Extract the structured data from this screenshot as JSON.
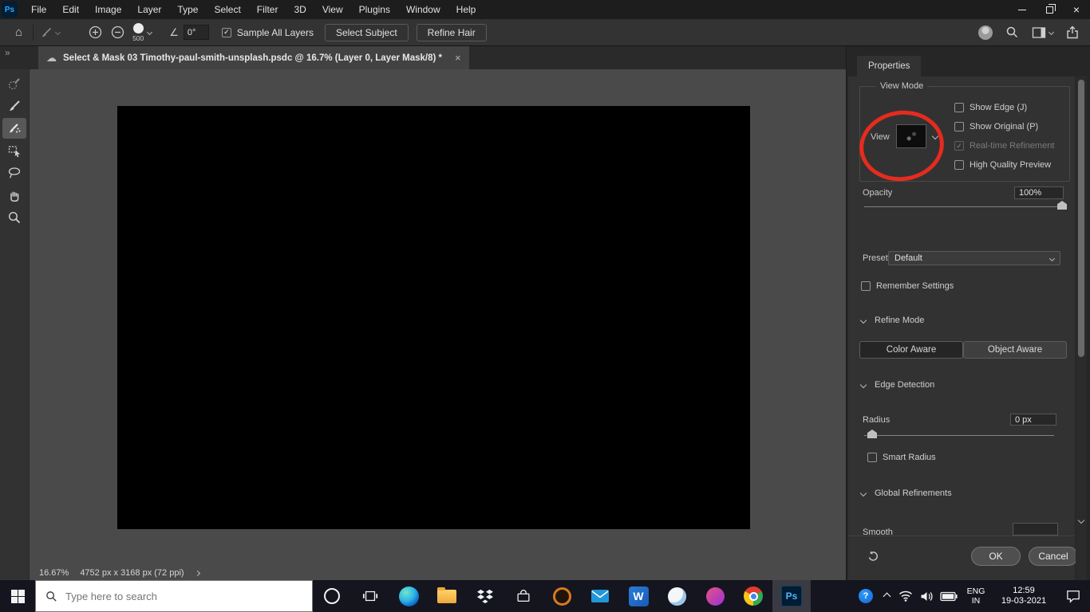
{
  "app": {
    "name_logo": "Ps"
  },
  "colors": {
    "ps_brand_blue": "#31a8ff",
    "annotation_red": "#e62b1e"
  },
  "menubar": {
    "items": [
      "File",
      "Edit",
      "Image",
      "Layer",
      "Type",
      "Select",
      "Filter",
      "3D",
      "View",
      "Plugins",
      "Window",
      "Help"
    ]
  },
  "window_controls": {
    "close_glyph": "×"
  },
  "options": {
    "home_glyph": "⌂",
    "brush_size": "500",
    "angle_glyph": "∠",
    "angle_value": "0°",
    "sample_all_layers": {
      "label": "Sample All Layers",
      "check": "✓"
    },
    "select_subject": "Select Subject",
    "refine_hair": "Refine Hair"
  },
  "tabstrip": {
    "overflow_glyph": "»"
  },
  "document_tab": {
    "cloud_glyph": "☁",
    "title": "Select & Mask 03 Timothy-paul-smith-unsplash.psdc @ 16.7% (Layer 0, Layer Mask/8) *",
    "close_glyph": "×"
  },
  "panel": {
    "tab_label": "Properties",
    "view_mode": {
      "group_label": "View Mode",
      "view_label": "View",
      "checkboxes": [
        {
          "label": "Show Edge (J)",
          "check": ""
        },
        {
          "label": "Show Original (P)",
          "check": ""
        },
        {
          "label": "Real-time Refinement",
          "check": "✓",
          "disabled": true
        },
        {
          "label": "High Quality Preview",
          "check": ""
        }
      ]
    },
    "opacity": {
      "label": "Opacity",
      "value": "100%"
    },
    "preset": {
      "label": "Preset",
      "value": "Default"
    },
    "remember_settings": {
      "label": "Remember Settings",
      "check": ""
    },
    "refine_mode": {
      "label": "Refine Mode",
      "color_aware": "Color Aware",
      "object_aware": "Object Aware",
      "selected": "Color Aware"
    },
    "edge_detection": {
      "label": "Edge Detection",
      "radius_label": "Radius",
      "radius_value": "0 px",
      "smart_radius": {
        "label": "Smart Radius",
        "check": ""
      }
    },
    "global_refinements": {
      "label": "Global Refinements",
      "smooth_label": "Smooth"
    },
    "footer": {
      "ok": "OK",
      "cancel": "Cancel"
    }
  },
  "statusbar": {
    "zoom": "16.67%",
    "doc_info": "4752 px x 3168 px (72 ppi)"
  },
  "taskbar": {
    "search_placeholder": "Type here to search",
    "word_glyph": "W",
    "help_glyph": "?",
    "language": {
      "line1": "ENG",
      "line2": "IN"
    },
    "clock": {
      "time": "12:59",
      "date": "19-03-2021"
    }
  }
}
